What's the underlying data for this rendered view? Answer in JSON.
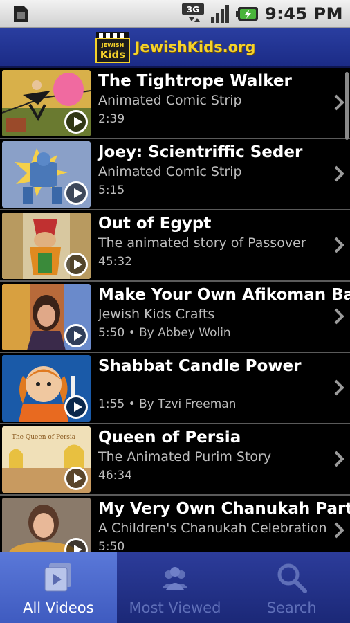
{
  "status": {
    "time": "9:45 PM",
    "network": "3G"
  },
  "app": {
    "title": "JewishKids.org",
    "badge_top": "JEWISH",
    "badge_bottom": "Kids"
  },
  "videos": [
    {
      "title": "The Tightrope Walker",
      "subtitle": "Animated Comic Strip",
      "meta": "2:39"
    },
    {
      "title": "Joey: Scientriffic Seder",
      "subtitle": "Animated Comic Strip",
      "meta": "5:15"
    },
    {
      "title": "Out of Egypt",
      "subtitle": "The animated story of Passover",
      "meta": "45:32"
    },
    {
      "title": "Make Your Own Afikoman Bag",
      "subtitle": "Jewish Kids Crafts",
      "meta": "5:50 • By Abbey Wolin"
    },
    {
      "title": "Shabbat Candle Power",
      "subtitle": "",
      "meta": "1:55 • By Tzvi Freeman"
    },
    {
      "title": "Queen of Persia",
      "subtitle": "The Animated Purim Story",
      "meta": "46:34"
    },
    {
      "title": "My Very Own Chanukah Party",
      "subtitle": "A Children's Chanukah Celebration",
      "meta": "5:50"
    }
  ],
  "thumb_text": {
    "queen": "The Queen of Persia"
  },
  "tabs": [
    {
      "label": "All Videos",
      "icon": "video-icon",
      "active": true
    },
    {
      "label": "Most Viewed",
      "icon": "people-icon",
      "active": false
    },
    {
      "label": "Search",
      "icon": "search-icon",
      "active": false
    }
  ],
  "colors": {
    "accent": "#1b2b86",
    "logo": "#f5d22a",
    "active_tab": "#4a66cc"
  }
}
